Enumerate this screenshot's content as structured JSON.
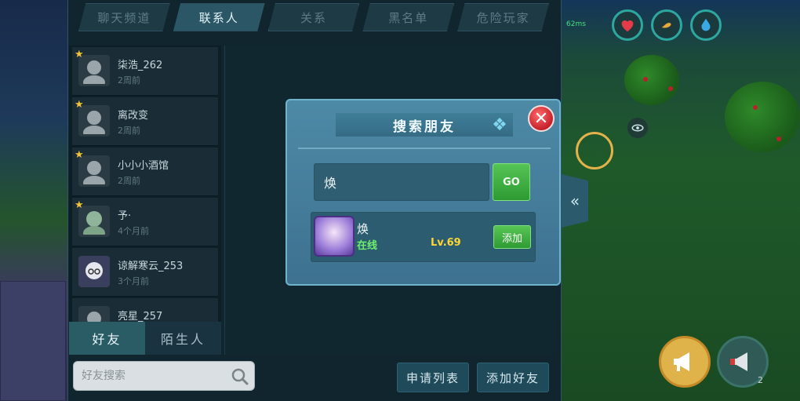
{
  "tabs": [
    {
      "label": "聊天频道",
      "active": false
    },
    {
      "label": "联系人",
      "active": true
    },
    {
      "label": "关系",
      "active": false
    },
    {
      "label": "黑名单",
      "active": false
    },
    {
      "label": "危险玩家",
      "active": false
    }
  ],
  "contacts": [
    {
      "name": "柒浩_262",
      "time": "2周前",
      "starred": true
    },
    {
      "name": "离改变",
      "time": "2周前",
      "starred": true
    },
    {
      "name": "小小小酒馆",
      "time": "2周前",
      "starred": true
    },
    {
      "name": "予·",
      "time": "4个月前",
      "starred": true
    },
    {
      "name": "谅解寒云_253",
      "time": "3个月前",
      "starred": false
    },
    {
      "name": "亮星_257",
      "time": "",
      "starred": false
    }
  ],
  "bottom_tabs": [
    {
      "label": "好友",
      "active": true
    },
    {
      "label": "陌生人",
      "active": false
    }
  ],
  "friend_search": {
    "placeholder": "好友搜索"
  },
  "actions": {
    "apply_list": "申请列表",
    "add_friend": "添加好友"
  },
  "modal": {
    "title": "搜索朋友",
    "input_value": "焕",
    "go_label": "GO",
    "result": {
      "name": "焕",
      "status": "在线",
      "level": "Lv.69",
      "add_label": "添加"
    }
  },
  "hud": {
    "signal": "62ms",
    "notification_count": "2"
  },
  "colors": {
    "online": "#6ef06c",
    "level": "#ffd633",
    "close": "#c5212b",
    "go": "#2e9a33"
  }
}
